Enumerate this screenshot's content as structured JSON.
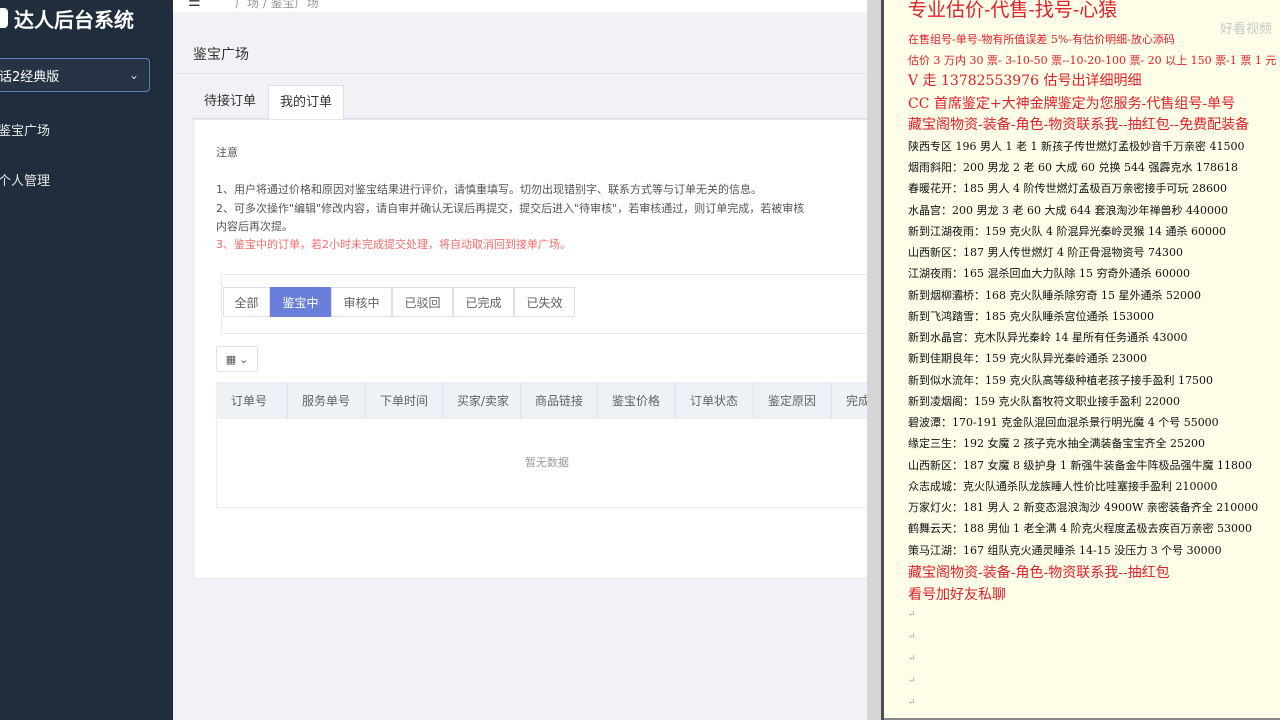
{
  "sidebar": {
    "title": "达人后台系统",
    "select_value": "话2经典版",
    "items": [
      "鉴宝广场",
      "个人管理"
    ]
  },
  "header": {
    "breadcrumb": "广场 / 鉴宝广场"
  },
  "main": {
    "page_title": "鉴宝广场",
    "tabs": [
      "待接订单",
      "我的订单"
    ],
    "notice": {
      "title": "注意",
      "lines": [
        "1、用户将通过价格和原因对鉴宝结果进行评价，请慎重填写。切勿出现错别字、联系方式等与订单无关的信息。",
        "2、可多次操作\"编辑\"修改内容，请自审并确认无误后再提交，提交后进入\"待审核\"，若审核通过，则订单完成，若被审核",
        "内容后再次提。",
        "3、鉴宝中的订单，若2小时未完成提交处理，将自动取消回到接单广场。"
      ]
    },
    "filters": [
      "全部",
      "鉴宝中",
      "审核中",
      "已驳回",
      "已完成",
      "已失效"
    ],
    "active_filter": 1,
    "columns": [
      "订单号",
      "服务单号",
      "下单时间",
      "买家/卖家",
      "商品链接",
      "鉴宝价格",
      "订单状态",
      "鉴定原因",
      "完成"
    ],
    "empty_text": "暂无数据"
  },
  "doc": {
    "watermark": "好看视频",
    "lines": [
      "专业估价-代售-找号-心猿",
      "在售组号-单号-物有所值误差 5%-有估价明细-放心添码",
      "估价 3 万内 30 票- 3-10-50 票--10-20-100 票- 20 以上 150 票-1 票 1 元",
      "V 走    13782553976   估号出详细明细",
      "CC 首席鉴定+大神金牌鉴定为您服务-代售组号-单号",
      "藏宝阁物资-装备-角色-物资联系我--抽红包--免费配装备",
      "陕西专区 196 男人 1 老 1 新孩子传世燃灯孟极妙音千万亲密 41500",
      "烟雨斜阳：200 男龙 2 老 60 大成 60 兑换 544 强霹克水 178618",
      "春暖花开：185 男人 4 阶传世燃灯孟极百万亲密接手可玩 28600",
      "水晶宫：200 男龙 3 老 60 大成 644 套浪淘沙年禅兽秒 440000",
      "新到江湖夜雨：159 克火队 4 阶混异光秦岭灵猴 14 通杀 60000",
      "山西新区：187 男人传世燃灯 4 阶正骨混物资号 74300",
      "江湖夜雨：165 混杀回血大力队除 15 穷奇外通杀 60000",
      "新到烟柳灞桥：168 克火队睡杀除穷奇 15 星外通杀 52000",
      "新到飞鸿踏雪：185 克火队睡杀宫位通杀 153000",
      "新到水晶宫：克木队异光秦岭 14 星所有任务通杀 43000",
      "新到佳期良年：159 克火队异光秦岭通杀 23000",
      "新到似水流年：159 克火队高等级种植老孩子接手盈利 17500",
      "新到凌烟阁：159 克火队畜牧符文职业接手盈利 22000",
      "碧波潭：170-191 克金队混回血混杀景行明光魔 4 个号 55000",
      "缘定三生：192 女魔 2 孩子克水抽全满装备宝宝齐全 25200",
      "山西新区：187 女魔 8 级护身 1 新强牛装备金牛阵极品强牛魔 11800",
      "众志成城：克火队通杀队龙族睡人性价比哇塞接手盈利 210000",
      "万家灯火：181 男人 2 新变态混浪淘沙 4900W 亲密装备齐全 210000",
      "鹤舞云天：188 男仙 1 老全满 4 阶克火程度孟极去疾百万亲密 53000",
      "策马江湖：167 组队克火通灵睡杀 14-15 没压力 3 个号 30000",
      "藏宝阁物资-装备-角色-物资联系我--抽红包",
      "看号加好友私聊"
    ],
    "colors": {
      "red": "#e0202a",
      "black": "#111111"
    }
  }
}
